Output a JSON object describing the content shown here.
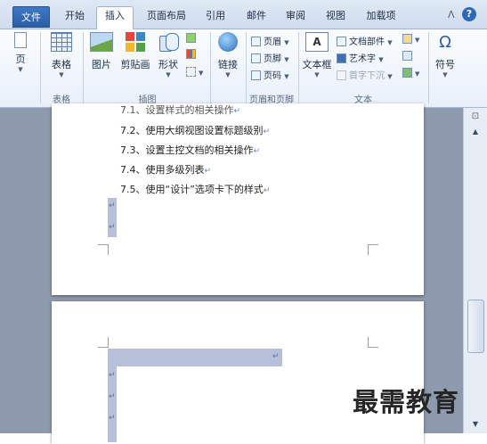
{
  "tabs": {
    "file": "文件",
    "home": "开始",
    "insert": "插入",
    "layout": "页面布局",
    "references": "引用",
    "mailings": "邮件",
    "review": "审阅",
    "view": "视图",
    "addins": "加载项"
  },
  "window": {
    "collapse_glyph": "ᐱ",
    "help_glyph": "?"
  },
  "ribbon": {
    "pages": {
      "label": "页"
    },
    "tables": {
      "button": "表格",
      "group": "表格"
    },
    "illustrations": {
      "picture": "图片",
      "clipart": "剪贴画",
      "shapes": "形状",
      "group": "插图"
    },
    "links": {
      "button": "链接"
    },
    "header_footer": {
      "header": "页眉",
      "footer": "页脚",
      "page_number": "页码",
      "group": "页眉和页脚"
    },
    "text": {
      "textbox": "文本框",
      "textbox_glyph": "A",
      "quick_parts": "文档部件",
      "wordart": "艺术字",
      "dropcap": "首字下沉",
      "group": "文本"
    },
    "symbols": {
      "button": "符号",
      "glyph": "Ω"
    }
  },
  "document": {
    "page1_lines": [
      "7.1、设置样式的相关操作",
      "7.2、使用大纲视图设置标题级别",
      "7.3、设置主控文档的相关操作",
      "7.4、使用多级列表",
      "7.5、使用“设计”选项卡下的样式"
    ],
    "para_mark": "↵"
  },
  "scrollbar": {
    "ruler_glyph": "⊡",
    "up_arrow": "▲",
    "down_arrow": "▼"
  },
  "watermark": "最需教育"
}
